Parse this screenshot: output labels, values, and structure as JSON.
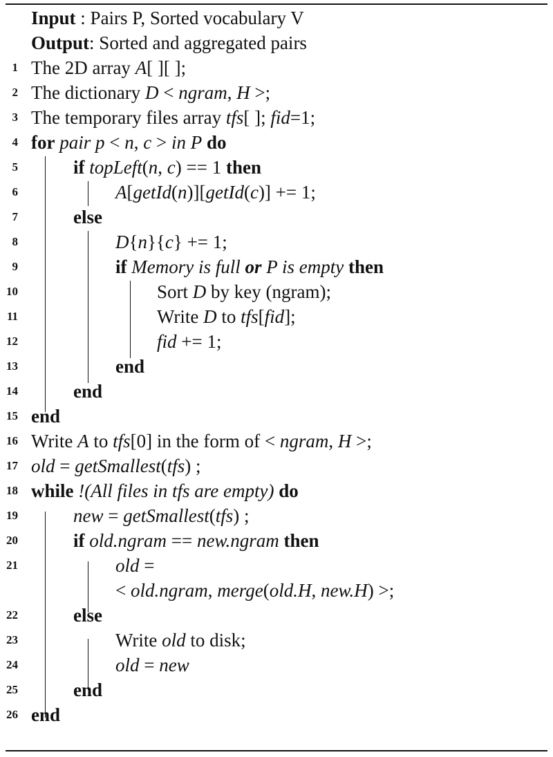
{
  "header": {
    "input_label": "Input",
    "input_text": "  : Pairs P, Sorted vocabulary V",
    "output_label": "Output",
    "output_text": ": Sorted and aggregated pairs"
  },
  "lines": [
    {
      "num": "1",
      "indent": 0,
      "html": "The 2D array <i>A</i>[ ][ ];"
    },
    {
      "num": "2",
      "indent": 0,
      "html": "The dictionary <i>D</i> &lt; <i>ngram</i>, <i>H</i> &gt;;"
    },
    {
      "num": "3",
      "indent": 0,
      "html": "The temporary files array <i>tfs</i>[ ]; <i>fid</i>=1;"
    },
    {
      "num": "4",
      "indent": 0,
      "html": "<b>for</b> <i>pair p</i> &lt; <i>n</i>, <i>c</i> &gt; <i>in P</i> <b>do</b>"
    },
    {
      "num": "5",
      "indent": 1,
      "html": "<b>if</b> <i>topLeft</i>(<i>n</i>, <i>c</i>) == 1 <b>then</b>"
    },
    {
      "num": "6",
      "indent": 2,
      "html": "<i>A</i>[<i>getId</i>(<i>n</i>)][<i>getId</i>(<i>c</i>)] += 1;"
    },
    {
      "num": "7",
      "indent": 1,
      "html": "<b>else</b>"
    },
    {
      "num": "8",
      "indent": 2,
      "html": "<i>D</i>{<i>n</i>}{<i>c</i>} += 1;"
    },
    {
      "num": "9",
      "indent": 2,
      "html": "<b>if</b> <i>Memory is full <b>or</b> P is empty</i> <b>then</b>"
    },
    {
      "num": "10",
      "indent": 3,
      "html": "Sort <i>D</i> by key (ngram);"
    },
    {
      "num": "11",
      "indent": 3,
      "html": "Write <i>D</i> to <i>tfs</i>[<i>fid</i>];"
    },
    {
      "num": "12",
      "indent": 3,
      "html": "<i>fid</i> += 1;"
    },
    {
      "num": "13",
      "indent": 2,
      "html": "<b>end</b>"
    },
    {
      "num": "14",
      "indent": 1,
      "html": "<b>end</b>"
    },
    {
      "num": "15",
      "indent": 0,
      "html": "<b>end</b>"
    },
    {
      "num": "16",
      "indent": 0,
      "html": "Write <i>A</i> to <i>tfs</i>[0] in the form of &lt; <i>ngram</i>, <i>H</i> &gt;;"
    },
    {
      "num": "17",
      "indent": 0,
      "html": "<i>old</i> = <i>getSmallest</i>(<i>tfs</i>) ;"
    },
    {
      "num": "18",
      "indent": 0,
      "html": "<b>while</b> <i>!(All files in tfs are empty)</i> <b>do</b>"
    },
    {
      "num": "19",
      "indent": 1,
      "html": "<i>new</i> = <i>getSmallest</i>(<i>tfs</i>) ;"
    },
    {
      "num": "20",
      "indent": 1,
      "html": "<b>if</b> <i>old.ngram</i> == <i>new.ngram</i> <b>then</b>"
    },
    {
      "num": "21",
      "indent": 2,
      "html": "<i>old</i> ="
    },
    {
      "num": "",
      "indent": 2,
      "html": "&lt; <i>old.ngram</i>, <i>merge</i>(<i>old.H</i>, <i>new.H</i>) &gt;;"
    },
    {
      "num": "22",
      "indent": 1,
      "html": "<b>else</b>"
    },
    {
      "num": "23",
      "indent": 2,
      "html": "Write <i>old</i> to disk;"
    },
    {
      "num": "24",
      "indent": 2,
      "html": "<i>old</i> = <i>new</i>"
    },
    {
      "num": "25",
      "indent": 1,
      "html": "<b>end</b>"
    },
    {
      "num": "26",
      "indent": 0,
      "html": "<b>end</b>"
    }
  ]
}
